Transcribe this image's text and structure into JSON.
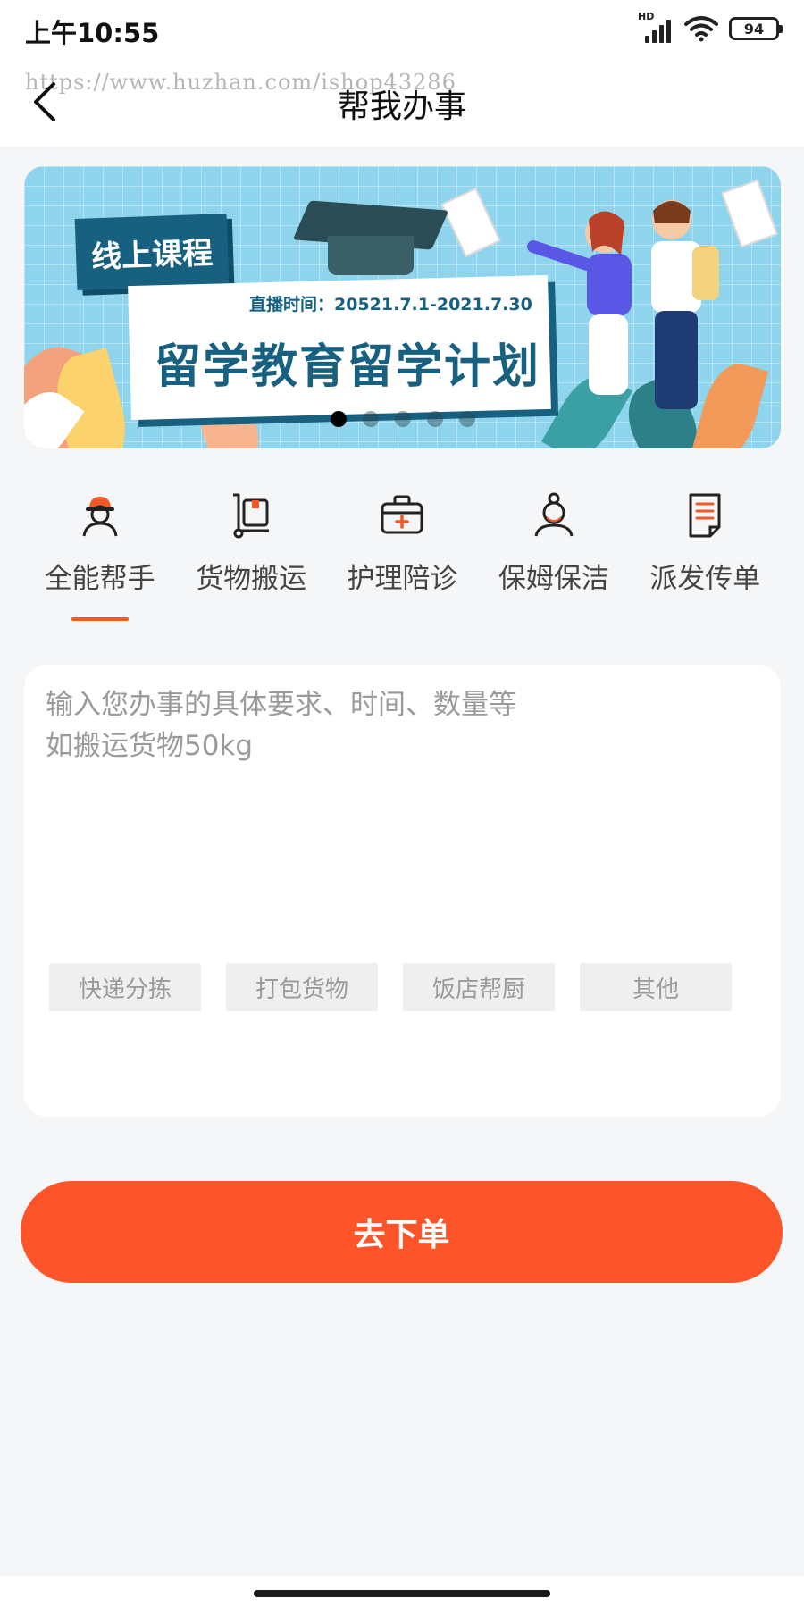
{
  "status_bar": {
    "time": "上午10:55",
    "network_badge": "HD",
    "battery": "94"
  },
  "header": {
    "title": "帮我办事",
    "watermark": "https://www.huzhan.com/ishop43286",
    "back_icon": "chevron-left-icon"
  },
  "banner": {
    "tag": "线上课程",
    "live_time": "直播时间：20521.7.1-2021.7.30",
    "headline": "留学教育留学计划",
    "slides_total": 5,
    "active_slide": 1
  },
  "categories": [
    {
      "label": "全能帮手",
      "icon": "worker-helmet-icon",
      "selected": true
    },
    {
      "label": "货物搬运",
      "icon": "hand-truck-icon",
      "selected": false
    },
    {
      "label": "护理陪诊",
      "icon": "medical-kit-icon",
      "selected": false
    },
    {
      "label": "保姆保洁",
      "icon": "nanny-icon",
      "selected": false
    },
    {
      "label": "派发传单",
      "icon": "flyer-document-icon",
      "selected": false
    }
  ],
  "request": {
    "placeholder": "输入您办事的具体要求、时间、数量等\n如搬运货物50kg",
    "value": ""
  },
  "quick_tags": [
    "快递分拣",
    "打包货物",
    "饭店帮厨",
    "其他"
  ],
  "submit_label": "去下单",
  "colors": {
    "accent": "#fd542a",
    "underline": "#f05a28",
    "banner_blue": "#17607f"
  }
}
